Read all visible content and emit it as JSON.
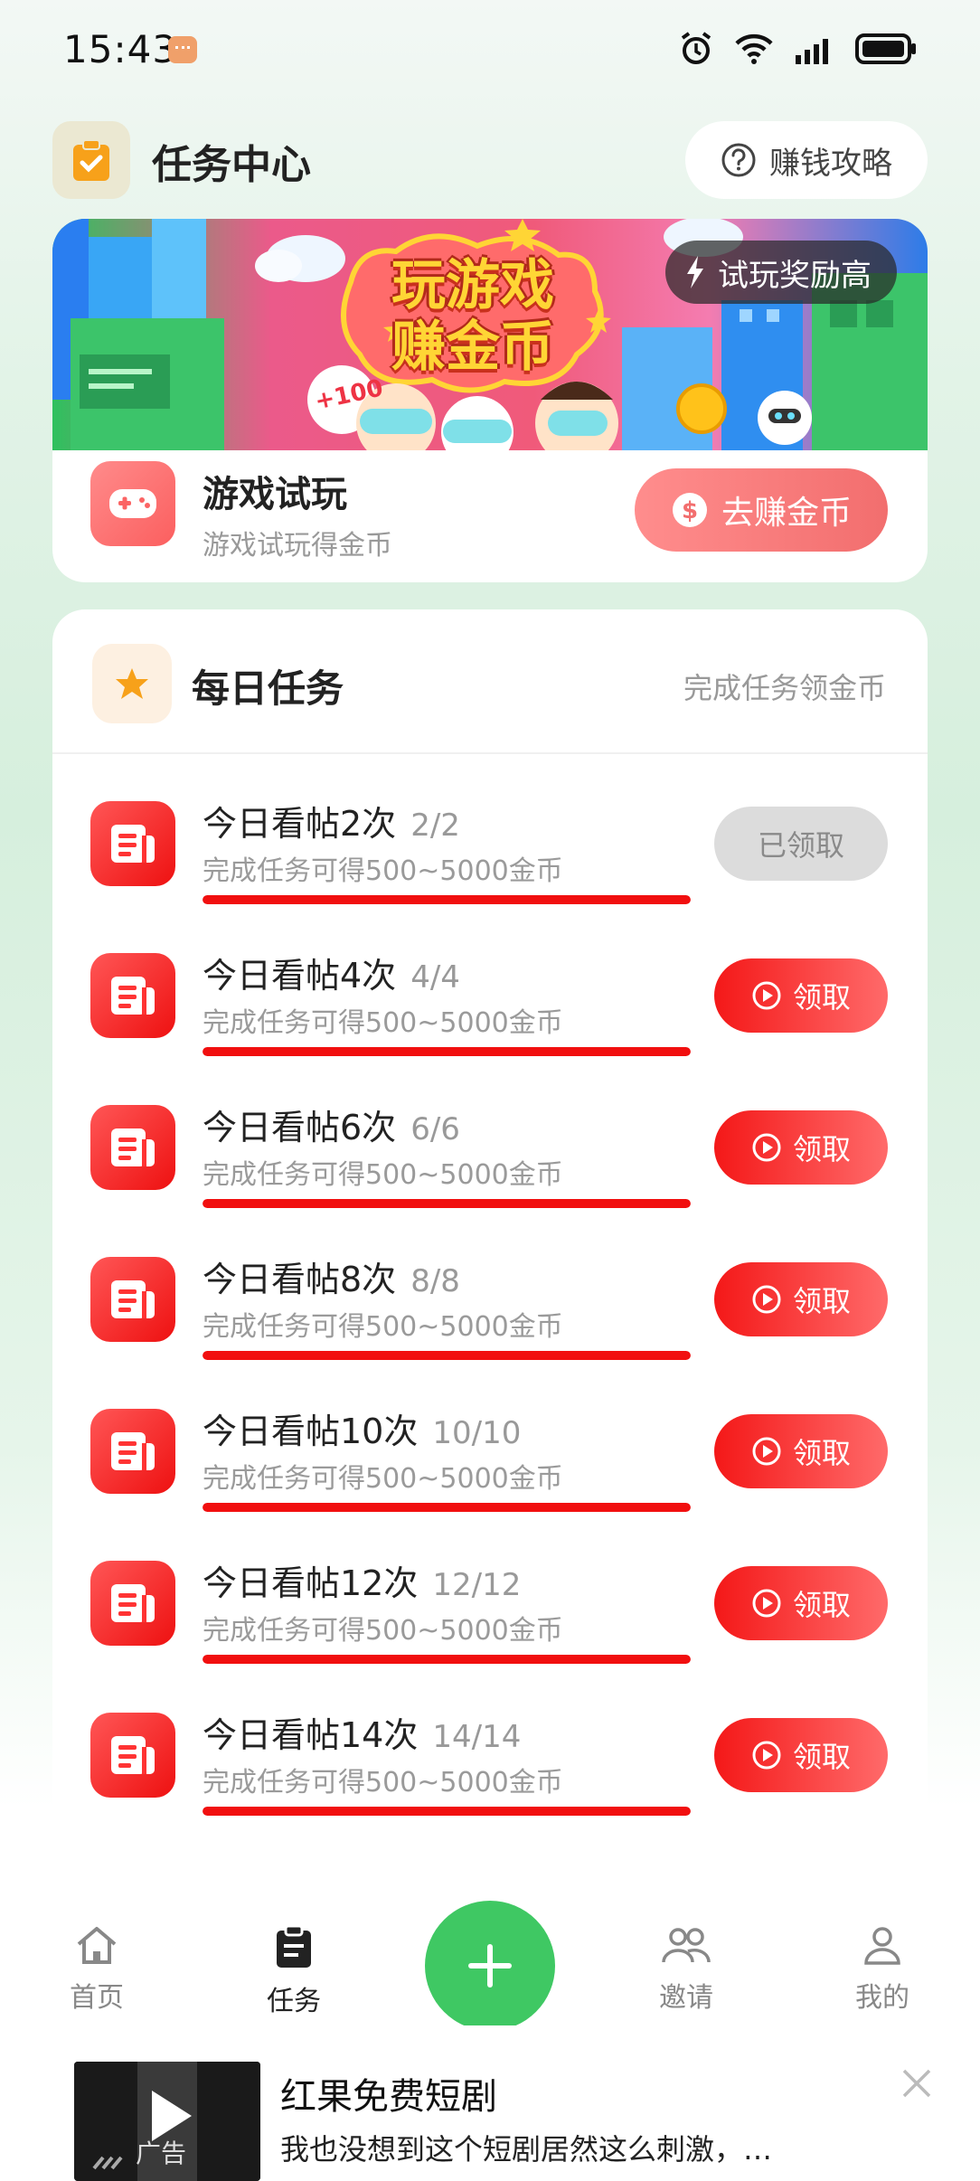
{
  "status_bar": {
    "time": "15:43"
  },
  "header": {
    "title": "任务中心",
    "guide_label": "赚钱攻略"
  },
  "game_card": {
    "banner_title_line1": "玩游戏",
    "banner_title_line2": "赚金币",
    "banner_badge": "试玩奖励高",
    "banner_sticker": "+100",
    "title": "游戏试玩",
    "subtitle": "游戏试玩得金币",
    "button_label": "去赚金币"
  },
  "daily": {
    "title": "每日任务",
    "hint": "完成任务领金币",
    "tasks": [
      {
        "title": "今日看帖2次",
        "count": "2/2",
        "desc": "完成任务可得500~5000金币",
        "progress": 1.0,
        "button": "已领取",
        "claimed": true
      },
      {
        "title": "今日看帖4次",
        "count": "4/4",
        "desc": "完成任务可得500~5000金币",
        "progress": 1.0,
        "button": "领取",
        "claimed": false
      },
      {
        "title": "今日看帖6次",
        "count": "6/6",
        "desc": "完成任务可得500~5000金币",
        "progress": 1.0,
        "button": "领取",
        "claimed": false
      },
      {
        "title": "今日看帖8次",
        "count": "8/8",
        "desc": "完成任务可得500~5000金币",
        "progress": 1.0,
        "button": "领取",
        "claimed": false
      },
      {
        "title": "今日看帖10次",
        "count": "10/10",
        "desc": "完成任务可得500~5000金币",
        "progress": 1.0,
        "button": "领取",
        "claimed": false
      },
      {
        "title": "今日看帖12次",
        "count": "12/12",
        "desc": "完成任务可得500~5000金币",
        "progress": 1.0,
        "button": "领取",
        "claimed": false
      },
      {
        "title": "今日看帖14次",
        "count": "14/14",
        "desc": "完成任务可得500~5000金币",
        "progress": 1.0,
        "button": "领取",
        "claimed": false
      }
    ]
  },
  "nav": {
    "items": [
      {
        "label": "首页",
        "icon": "home-icon",
        "active": false
      },
      {
        "label": "任务",
        "icon": "clipboard-icon",
        "active": true
      },
      {
        "label": "邀请",
        "icon": "people-icon",
        "active": false
      },
      {
        "label": "我的",
        "icon": "person-icon",
        "active": false
      }
    ],
    "fab_icon": "plus-icon"
  },
  "ad": {
    "label": "广告",
    "title": "红果免费短剧",
    "desc": "我也没想到这个短剧居然这么刺激，…"
  },
  "colors": {
    "accent_red": "#f10f0f",
    "green_fab": "#3fc863",
    "claimed_gray": "#dcdcdc"
  }
}
